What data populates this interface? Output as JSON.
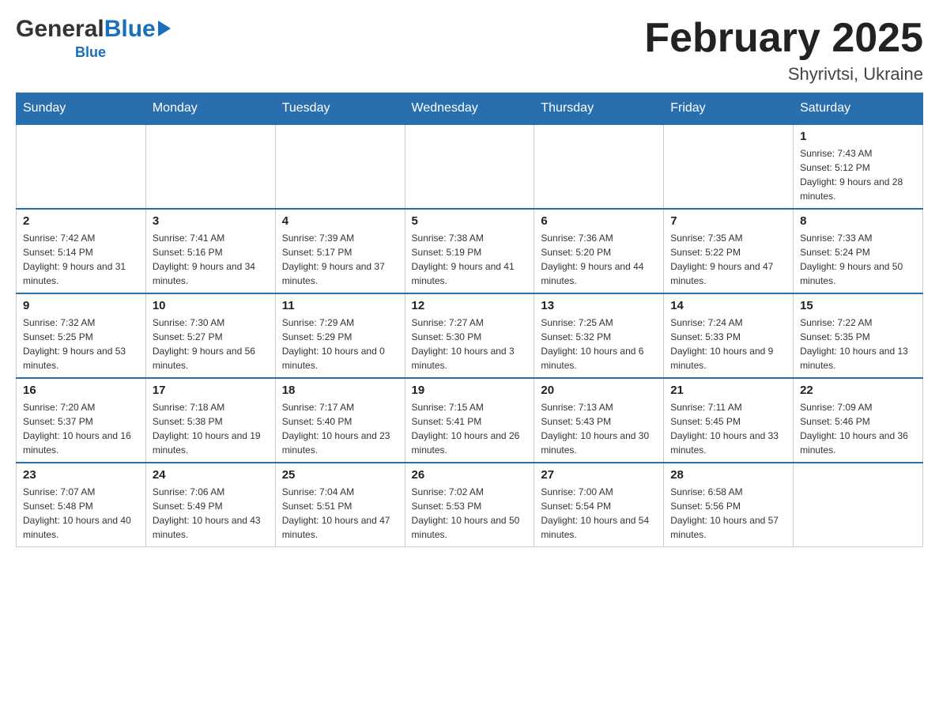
{
  "logo": {
    "general": "General",
    "blue": "Blue",
    "arrow_char": "▶"
  },
  "title": {
    "month_year": "February 2025",
    "location": "Shyrivtsi, Ukraine"
  },
  "days_of_week": [
    "Sunday",
    "Monday",
    "Tuesday",
    "Wednesday",
    "Thursday",
    "Friday",
    "Saturday"
  ],
  "weeks": [
    {
      "cells": [
        {
          "day": "",
          "info": ""
        },
        {
          "day": "",
          "info": ""
        },
        {
          "day": "",
          "info": ""
        },
        {
          "day": "",
          "info": ""
        },
        {
          "day": "",
          "info": ""
        },
        {
          "day": "",
          "info": ""
        },
        {
          "day": "1",
          "info": "Sunrise: 7:43 AM\nSunset: 5:12 PM\nDaylight: 9 hours and 28 minutes."
        }
      ]
    },
    {
      "cells": [
        {
          "day": "2",
          "info": "Sunrise: 7:42 AM\nSunset: 5:14 PM\nDaylight: 9 hours and 31 minutes."
        },
        {
          "day": "3",
          "info": "Sunrise: 7:41 AM\nSunset: 5:16 PM\nDaylight: 9 hours and 34 minutes."
        },
        {
          "day": "4",
          "info": "Sunrise: 7:39 AM\nSunset: 5:17 PM\nDaylight: 9 hours and 37 minutes."
        },
        {
          "day": "5",
          "info": "Sunrise: 7:38 AM\nSunset: 5:19 PM\nDaylight: 9 hours and 41 minutes."
        },
        {
          "day": "6",
          "info": "Sunrise: 7:36 AM\nSunset: 5:20 PM\nDaylight: 9 hours and 44 minutes."
        },
        {
          "day": "7",
          "info": "Sunrise: 7:35 AM\nSunset: 5:22 PM\nDaylight: 9 hours and 47 minutes."
        },
        {
          "day": "8",
          "info": "Sunrise: 7:33 AM\nSunset: 5:24 PM\nDaylight: 9 hours and 50 minutes."
        }
      ]
    },
    {
      "cells": [
        {
          "day": "9",
          "info": "Sunrise: 7:32 AM\nSunset: 5:25 PM\nDaylight: 9 hours and 53 minutes."
        },
        {
          "day": "10",
          "info": "Sunrise: 7:30 AM\nSunset: 5:27 PM\nDaylight: 9 hours and 56 minutes."
        },
        {
          "day": "11",
          "info": "Sunrise: 7:29 AM\nSunset: 5:29 PM\nDaylight: 10 hours and 0 minutes."
        },
        {
          "day": "12",
          "info": "Sunrise: 7:27 AM\nSunset: 5:30 PM\nDaylight: 10 hours and 3 minutes."
        },
        {
          "day": "13",
          "info": "Sunrise: 7:25 AM\nSunset: 5:32 PM\nDaylight: 10 hours and 6 minutes."
        },
        {
          "day": "14",
          "info": "Sunrise: 7:24 AM\nSunset: 5:33 PM\nDaylight: 10 hours and 9 minutes."
        },
        {
          "day": "15",
          "info": "Sunrise: 7:22 AM\nSunset: 5:35 PM\nDaylight: 10 hours and 13 minutes."
        }
      ]
    },
    {
      "cells": [
        {
          "day": "16",
          "info": "Sunrise: 7:20 AM\nSunset: 5:37 PM\nDaylight: 10 hours and 16 minutes."
        },
        {
          "day": "17",
          "info": "Sunrise: 7:18 AM\nSunset: 5:38 PM\nDaylight: 10 hours and 19 minutes."
        },
        {
          "day": "18",
          "info": "Sunrise: 7:17 AM\nSunset: 5:40 PM\nDaylight: 10 hours and 23 minutes."
        },
        {
          "day": "19",
          "info": "Sunrise: 7:15 AM\nSunset: 5:41 PM\nDaylight: 10 hours and 26 minutes."
        },
        {
          "day": "20",
          "info": "Sunrise: 7:13 AM\nSunset: 5:43 PM\nDaylight: 10 hours and 30 minutes."
        },
        {
          "day": "21",
          "info": "Sunrise: 7:11 AM\nSunset: 5:45 PM\nDaylight: 10 hours and 33 minutes."
        },
        {
          "day": "22",
          "info": "Sunrise: 7:09 AM\nSunset: 5:46 PM\nDaylight: 10 hours and 36 minutes."
        }
      ]
    },
    {
      "cells": [
        {
          "day": "23",
          "info": "Sunrise: 7:07 AM\nSunset: 5:48 PM\nDaylight: 10 hours and 40 minutes."
        },
        {
          "day": "24",
          "info": "Sunrise: 7:06 AM\nSunset: 5:49 PM\nDaylight: 10 hours and 43 minutes."
        },
        {
          "day": "25",
          "info": "Sunrise: 7:04 AM\nSunset: 5:51 PM\nDaylight: 10 hours and 47 minutes."
        },
        {
          "day": "26",
          "info": "Sunrise: 7:02 AM\nSunset: 5:53 PM\nDaylight: 10 hours and 50 minutes."
        },
        {
          "day": "27",
          "info": "Sunrise: 7:00 AM\nSunset: 5:54 PM\nDaylight: 10 hours and 54 minutes."
        },
        {
          "day": "28",
          "info": "Sunrise: 6:58 AM\nSunset: 5:56 PM\nDaylight: 10 hours and 57 minutes."
        },
        {
          "day": "",
          "info": ""
        }
      ]
    }
  ]
}
